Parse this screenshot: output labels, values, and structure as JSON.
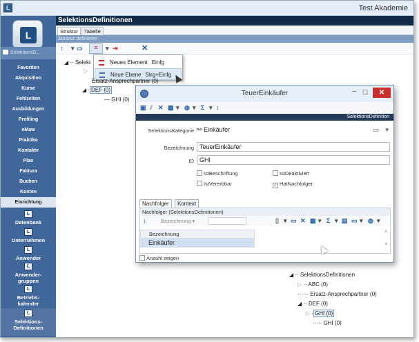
{
  "app": {
    "title": "Test Akademie",
    "icon": "app-logo-icon"
  },
  "sidebar": {
    "current_label": "SelektionsD...",
    "nav_items": [
      {
        "label": "Favoriten"
      },
      {
        "label": "Akquisition"
      },
      {
        "label": "Kurse"
      },
      {
        "label": "Fehlzeiten"
      },
      {
        "label": "Ausbildungen"
      },
      {
        "label": "Profiling"
      },
      {
        "label": "eMaw"
      },
      {
        "label": "Praktika"
      },
      {
        "label": "Kontakte"
      },
      {
        "label": "Plan"
      },
      {
        "label": "Faktura"
      },
      {
        "label": "Buchen"
      },
      {
        "label": "Konten"
      },
      {
        "label": "Einrichtung"
      }
    ],
    "tiles": [
      {
        "label": "Datenbank"
      },
      {
        "label": "Unternehmen"
      },
      {
        "label": "Anwender"
      },
      {
        "label": "Anwender-gruppen",
        "lines": [
          "Anwender-",
          "gruppen"
        ]
      },
      {
        "label": "Betriebs-kalender",
        "lines": [
          "Betriebs-",
          "kalender"
        ]
      },
      {
        "label": "Selektions-Definitionen",
        "lines": [
          "Selektions-",
          "Definitionen"
        ]
      }
    ]
  },
  "document": {
    "title": "SelektionsDefinitionen",
    "tabs": [
      {
        "label": "Struktur"
      },
      {
        "label": "Tabelle"
      }
    ],
    "subheader": "Struktur definieren",
    "toolbar": [
      "sort-icon",
      "folder-icon",
      "list-icon",
      "export-icon",
      "delete-icon"
    ]
  },
  "context_menu": {
    "items": [
      {
        "label": "Neues Element",
        "shortcut": "Einfg",
        "icon": "list-icon"
      },
      {
        "label": "Neue Ebene",
        "shortcut": "Strg+Einfg",
        "icon": "level-icon"
      }
    ]
  },
  "tree_top": {
    "root": "Selekt",
    "items": [
      "Ersatz-Ansprechpartner (0)",
      "DEF (0)",
      "GHI (0)"
    ]
  },
  "dialog": {
    "title": "TeuerEinkäufer",
    "band": "SelektionsDefinition",
    "fields": {
      "kategorie_label": "SelektionsKategorie",
      "kategorie_value": "Einkäufer",
      "bezeichnung_label": "Bezeichnung",
      "bezeichnung_value": "TeuerEinkäufer",
      "id_label": "ID",
      "id_value": "GHI"
    },
    "checkboxes": [
      {
        "label": "IstBeschriftung",
        "checked": false
      },
      {
        "label": "IstDeaktiviert",
        "checked": false
      },
      {
        "label": "IstVererbbar",
        "checked": false
      },
      {
        "label": "HatNachfolger",
        "checked": true
      }
    ],
    "tabs": [
      {
        "label": "Nachfolger"
      },
      {
        "label": "Kontext"
      }
    ],
    "sublist": {
      "header": "Nachfolger (SelektionsDefinitionen)",
      "sort_field": "Bezeichnung",
      "column": "Bezeichnung",
      "rows": [
        "Einkäufer"
      ]
    },
    "anzahl_label": "Anzahl zeigen"
  },
  "tree_bottom": {
    "items": [
      "SelektionsDefinitionen",
      "ABC (0)",
      "Ersatz-Ansprechpartner (0)",
      "DEF (0)",
      "GHI (0)",
      "GHI (0)"
    ]
  }
}
